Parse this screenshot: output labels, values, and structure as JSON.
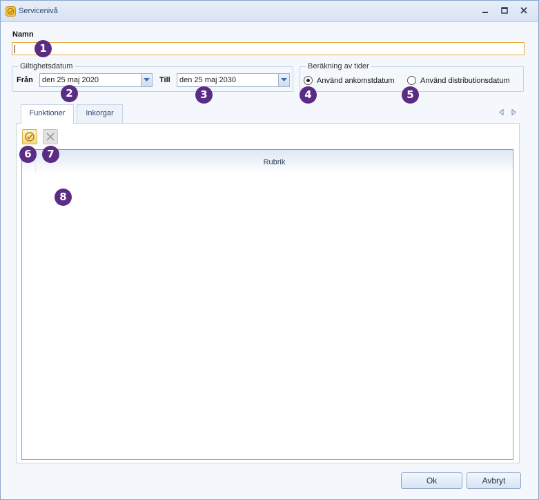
{
  "window": {
    "title": "Servicenivå"
  },
  "form": {
    "name_label": "Namn",
    "name_value": "",
    "validity": {
      "legend": "Giltighetsdatum",
      "from_label": "Från",
      "from_value": "den 25 maj 2020",
      "to_label": "Till",
      "to_value": "den 25 maj 2030"
    },
    "timecalc": {
      "legend": "Beräkning av tider",
      "options": [
        {
          "label": "Använd ankomstdatum",
          "selected": true
        },
        {
          "label": "Använd distributionsdatum",
          "selected": false
        }
      ]
    }
  },
  "tabs": [
    {
      "label": "Funktioner",
      "active": true
    },
    {
      "label": "Inkorgar",
      "active": false
    }
  ],
  "grid": {
    "columns": [
      "Rubrik"
    ],
    "rows": []
  },
  "buttons": {
    "ok": "Ok",
    "cancel": "Avbryt"
  },
  "callouts": [
    "1",
    "2",
    "3",
    "4",
    "5",
    "6",
    "7",
    "8"
  ],
  "colors": {
    "callout": "#5b2c83",
    "focus_border": "#e8a93a"
  }
}
